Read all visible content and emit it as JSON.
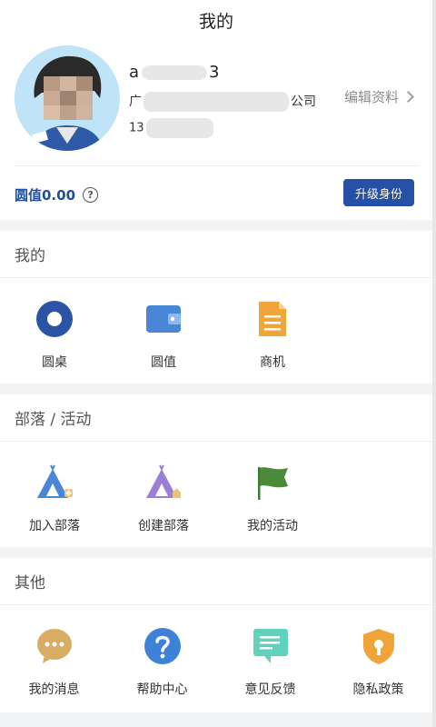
{
  "header": {
    "title": "我的"
  },
  "profile": {
    "name_prefix": "a",
    "name_suffix": "3",
    "company_prefix": "广",
    "company_suffix": "公司",
    "phone_prefix": "13",
    "edit_label": "编辑资料",
    "balance_label": "圆值0.00",
    "help_symbol": "?",
    "upgrade_label": "升级身份"
  },
  "sections": {
    "mine": {
      "title": "我的",
      "items": [
        {
          "label": "圆桌",
          "icon": "round-table-icon"
        },
        {
          "label": "圆值",
          "icon": "wallet-icon"
        },
        {
          "label": "商机",
          "icon": "document-icon"
        }
      ]
    },
    "tribe": {
      "title": "部落 / 活动",
      "items": [
        {
          "label": "加入部落",
          "icon": "tent-join-icon"
        },
        {
          "label": "创建部落",
          "icon": "tent-create-icon"
        },
        {
          "label": "我的活动",
          "icon": "flag-icon"
        }
      ]
    },
    "other": {
      "title": "其他",
      "items": [
        {
          "label": "我的消息",
          "icon": "chat-bubble-icon"
        },
        {
          "label": "帮助中心",
          "icon": "help-icon"
        },
        {
          "label": "意见反馈",
          "icon": "feedback-icon"
        },
        {
          "label": "隐私政策",
          "icon": "lock-shield-icon"
        }
      ]
    }
  },
  "colors": {
    "accent": "#2450a6",
    "balance": "#1f4e9c",
    "blue_icon": "#2b55a4",
    "wallet": "#4a86d6",
    "doc": "#f0a53a",
    "tent_blue": "#4a86d6",
    "tent_purple": "#9b7fd6",
    "flag": "#4a8a3a",
    "chat": "#d9ad63",
    "help": "#3d82d6",
    "feedback": "#5fd1bd",
    "lock": "#f0a53a"
  }
}
